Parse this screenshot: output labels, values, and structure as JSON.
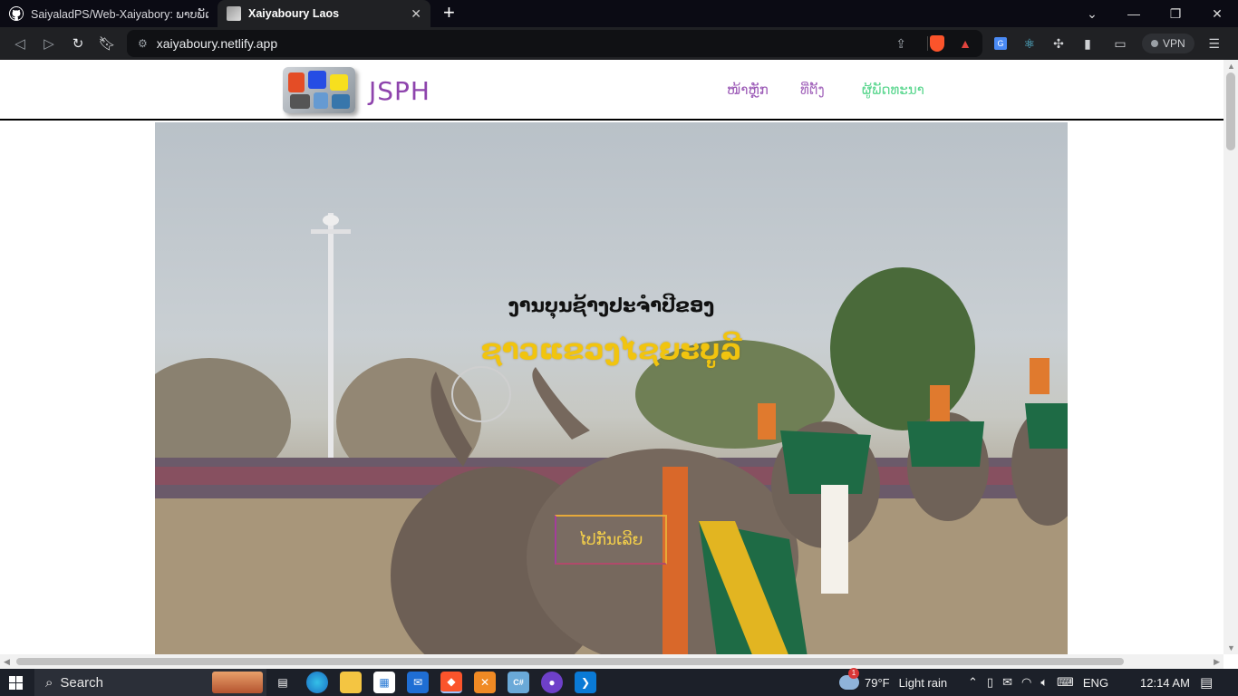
{
  "browser": {
    "tabs": [
      {
        "title": "SaiyaladPS/Web-Xaiyabory: ພາບພັດທະ",
        "icon": "github-icon",
        "active": false
      },
      {
        "title": "Xaiyaboury Laos",
        "icon": "site-favicon-icon",
        "active": true
      }
    ],
    "new_tab": "+",
    "url": "xaiyaboury.netlify.app",
    "vpn_label": "VPN"
  },
  "site": {
    "brand": "JSPH",
    "nav": [
      {
        "label": "ໜ້າຫຼັກ",
        "color": "#9b59b6"
      },
      {
        "label": "ທີ່ຕັ້ງ",
        "color": "#a569bd"
      },
      {
        "label": "ຜູ້ພັດທະນາ",
        "color": "#58d68d"
      }
    ],
    "hero": {
      "title": "ງານບຸນຊ້າງປະຈຳປີຂອງ",
      "subtitle": "ຊາວແຂວງໄຊຍະບູລີ",
      "button": "ໄປກັນເລີຍ"
    }
  },
  "taskbar": {
    "search_label": "Search",
    "weather_temp": "79°F",
    "weather_desc": "Light rain",
    "weather_badge": "1",
    "language": "ENG",
    "time": "12:14 AM"
  }
}
